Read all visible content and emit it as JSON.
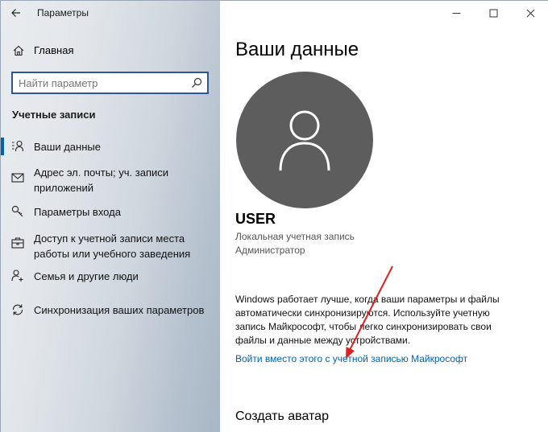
{
  "window": {
    "title": "Параметры"
  },
  "sidebar": {
    "home_label": "Главная",
    "search_placeholder": "Найти параметр",
    "section_title": "Учетные записи",
    "items": [
      {
        "label": "Ваши данные",
        "icon": "user-list-icon",
        "selected": true
      },
      {
        "label": "Адрес эл. почты; уч. записи приложений",
        "icon": "mail-icon",
        "selected": false
      },
      {
        "label": "Параметры входа",
        "icon": "key-icon",
        "selected": false
      },
      {
        "label": "Доступ к учетной записи места работы или учебного заведения",
        "icon": "briefcase-icon",
        "selected": false
      },
      {
        "label": "Семья и другие люди",
        "icon": "person-add-icon",
        "selected": false
      },
      {
        "label": "Синхронизация ваших параметров",
        "icon": "sync-icon",
        "selected": false
      }
    ]
  },
  "main": {
    "page_title": "Ваши данные",
    "user_name": "USER",
    "account_type": "Локальная учетная запись",
    "account_role": "Администратор",
    "info_text": "Windows работает лучше, когда ваши параметры и файлы автоматически синхронизируются. Используйте учетную запись Майкрософт, чтобы легко синхронизировать свои файлы и данные между устройствами.",
    "ms_link": "Войти вместо этого с учетной записью Майкрософт",
    "avatar_section_title": "Создать аватар"
  },
  "colors": {
    "accent": "#0063b1",
    "arrow": "#e02020",
    "avatar_bg": "#5d5d5d"
  }
}
